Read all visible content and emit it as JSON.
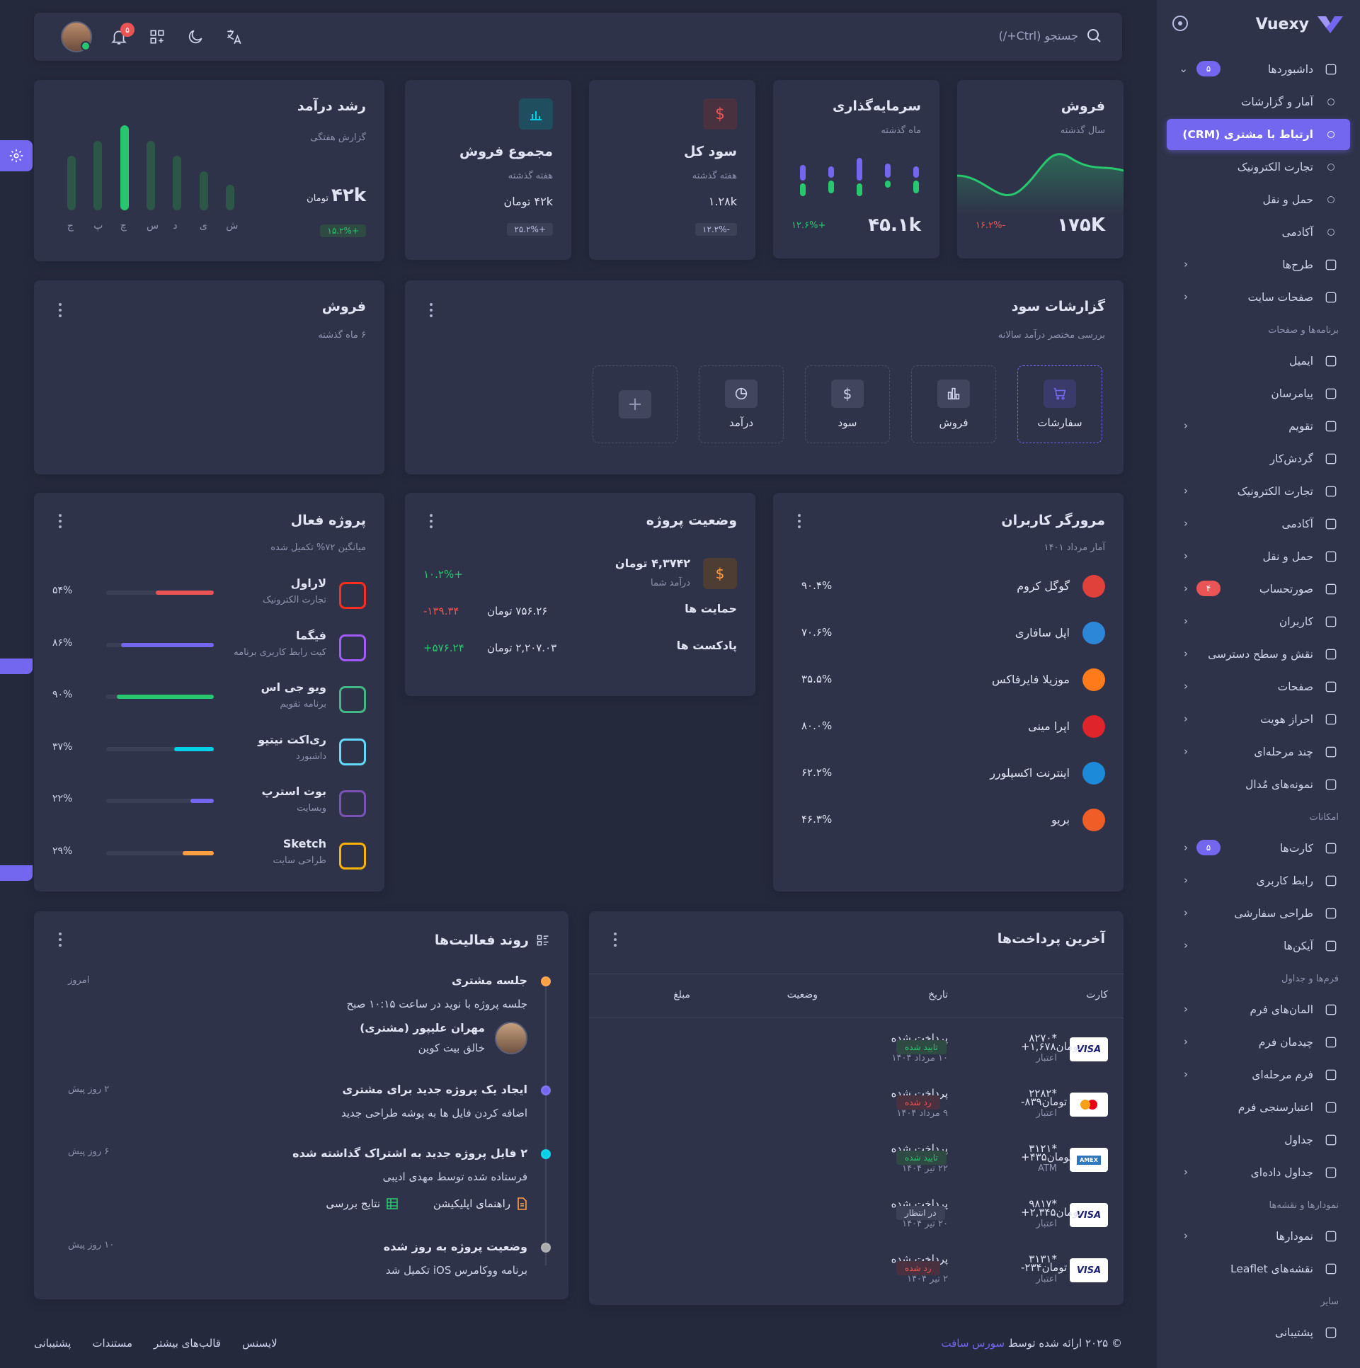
{
  "brand": {
    "name": "Vuexy",
    "accent": "#7367f0"
  },
  "navbar": {
    "search_placeholder": "جستجو (Ctrl+/)",
    "notifications_count": "۵"
  },
  "sidebar": {
    "items": [
      {
        "label": "داشبوردها",
        "icon": "home-icon",
        "badge": "۵",
        "chevron": "⌄"
      },
      {
        "label": "آمار و گزارشات",
        "sub": true
      },
      {
        "label": "ارتباط با مشتری (CRM)",
        "sub": true,
        "active": true
      },
      {
        "label": "تجارت الکترونیک",
        "sub": true
      },
      {
        "label": "حمل و نقل",
        "sub": true
      },
      {
        "label": "آکادمی",
        "sub": true
      },
      {
        "label": "طرح‌ها",
        "icon": "layout-icon",
        "chevron": "‹"
      },
      {
        "label": "صفحات سایت",
        "icon": "files-icon",
        "chevron": "‹"
      },
      {
        "section": "برنامه‌ها و صفحات"
      },
      {
        "label": "ایمیل",
        "icon": "mail-icon"
      },
      {
        "label": "پیامرسان",
        "icon": "chat-icon"
      },
      {
        "label": "تقویم",
        "icon": "calendar-icon",
        "chevron": "‹"
      },
      {
        "label": "گردش‌کار",
        "icon": "kanban-icon"
      },
      {
        "label": "تجارت الکترونیک",
        "icon": "cart-icon",
        "chevron": "‹"
      },
      {
        "label": "آکادمی",
        "icon": "book-icon",
        "chevron": "‹"
      },
      {
        "label": "حمل و نقل",
        "icon": "truck-icon",
        "chevron": "‹"
      },
      {
        "label": "صورتحساب",
        "icon": "invoice-icon",
        "badge": "۴",
        "badge_red": true,
        "chevron": "‹"
      },
      {
        "label": "کاربران",
        "icon": "users-icon",
        "chevron": "‹"
      },
      {
        "label": "نقش و سطح دسترسی",
        "icon": "settings-icon",
        "chevron": "‹"
      },
      {
        "label": "صفحات",
        "icon": "file-icon",
        "chevron": "‹"
      },
      {
        "label": "احراز هویت",
        "icon": "lock-icon",
        "chevron": "‹"
      },
      {
        "label": "چند مرحله‌ای",
        "icon": "steps-icon",
        "chevron": "‹"
      },
      {
        "label": "نمونه‌های مُدال",
        "icon": "square-icon"
      },
      {
        "section": "امکانات"
      },
      {
        "label": "کارت‌ها",
        "icon": "id-card-icon",
        "badge": "۵",
        "chevron": "‹"
      },
      {
        "label": "رابط کاربری",
        "icon": "ui-icon",
        "chevron": "‹"
      },
      {
        "label": "طراحی سفارشی",
        "icon": "components-icon",
        "chevron": "‹"
      },
      {
        "label": "آیکن‌ها",
        "icon": "icons-icon",
        "chevron": "‹"
      },
      {
        "section": "فرم‌ها و جداول"
      },
      {
        "label": "المان‌های فرم",
        "icon": "toggle-icon",
        "chevron": "‹"
      },
      {
        "label": "چیدمان فرم",
        "icon": "form-layout-icon",
        "chevron": "‹"
      },
      {
        "label": "فرم مرحله‌ای",
        "icon": "wizard-icon",
        "chevron": "‹"
      },
      {
        "label": "اعتبارسنجی فرم",
        "icon": "checkbox-icon"
      },
      {
        "label": "جداول",
        "icon": "table-icon"
      },
      {
        "label": "جداول داده‌ای",
        "icon": "grid-icon",
        "chevron": "‹"
      },
      {
        "section": "نمودارها و نقشه‌ها"
      },
      {
        "label": "نمودارها",
        "icon": "chart-icon",
        "chevron": "‹"
      },
      {
        "label": "نقشه‌های Leaflet",
        "icon": "map-icon"
      },
      {
        "section": "سایر"
      },
      {
        "label": "پشتیبانی",
        "icon": "support-icon"
      }
    ]
  },
  "sales_card": {
    "title": "فروش",
    "sub": "سال گذشته",
    "value": "۱۷۵K",
    "change": "-۱۶.۲%"
  },
  "investment_card": {
    "title": "سرمایه‌گذاری",
    "sub": "ماه گذشته",
    "value": "۴۵.۱k",
    "change": "+۱۲.۶%"
  },
  "profit_card": {
    "title": "سود کل",
    "sub": "هفته گذشته",
    "value": "۱.۲۸k",
    "change": "-۱۲.۲%"
  },
  "total_sales_card": {
    "title": "مجموع فروش",
    "sub": "هفته گذشته",
    "value": "۴۲k تومان",
    "change": "+۲۵.۲%"
  },
  "revenue_card": {
    "title": "رشد درآمد",
    "sub": "گزارش هفتگی",
    "value": "۴۲k",
    "unit": "تومان",
    "change": "+۱۵.۲%",
    "days": [
      "ش",
      "ی",
      "د",
      "س",
      "چ",
      "پ",
      "ج"
    ],
    "bar_levels": [
      0.3,
      0.46,
      0.64,
      0.82,
      1.0,
      0.82,
      0.64
    ],
    "highlight_index": 4
  },
  "profit_reports": {
    "title": "گزارشات سود",
    "sub": "بررسی مختصر درآمد سالانه",
    "options": [
      "سفارشات",
      "فروش",
      "سود",
      "درآمد"
    ]
  },
  "sales_empty": {
    "title": "فروش",
    "sub": "۶ ماه گذشته"
  },
  "browsers": {
    "title": "مرورگر کاربران",
    "sub": "آمار مرداد ۱۴۰۱",
    "rows": [
      {
        "name": "گوگل کروم",
        "value": "۹۰.۴%",
        "logo": "chrome-icon"
      },
      {
        "name": "اپل سافاری",
        "value": "۷۰.۶%",
        "logo": "safari-icon"
      },
      {
        "name": "موزیلا فایرفاکس",
        "value": "۳۵.۵%",
        "logo": "firefox-icon"
      },
      {
        "name": "اپرا مینی",
        "value": "۸۰.۰%",
        "logo": "opera-icon"
      },
      {
        "name": "اینترنت اکسپلورر",
        "value": "۶۲.۲%",
        "logo": "ie-icon"
      },
      {
        "name": "بریو",
        "value": "۴۶.۳%",
        "logo": "brave-icon"
      }
    ]
  },
  "project_status": {
    "title": "وضعیت پروژه",
    "amount": "۴,۳۷۴۲ تومان",
    "amount_sub": "درآمد شما",
    "amount_change": "+۱۰.۲%",
    "rows": [
      {
        "label": "حمایت ها",
        "value": "۷۵۶.۲۶ تومان",
        "change": "-۱۳۹.۳۴"
      },
      {
        "label": "پادکست ها",
        "value": "۲,۲۰۷.۰۳ تومان",
        "change": "+۵۷۶.۲۴"
      }
    ]
  },
  "active_projects": {
    "title": "پروژه فعال",
    "sub": "میانگین ۷۲% تکمیل شده",
    "rows": [
      {
        "name": "لاراول",
        "desc": "تجارت الکترونیک",
        "pct": "۵۴%",
        "level": 0.54,
        "color": "#ea5455",
        "logo": "laravel-icon"
      },
      {
        "name": "فیگما",
        "desc": "کیت رابط کاربری برنامه",
        "pct": "۸۶%",
        "level": 0.86,
        "color": "#7367f0",
        "logo": "figma-icon"
      },
      {
        "name": "ویو جی اس",
        "desc": "برنامه تقویم",
        "pct": "۹۰%",
        "level": 0.9,
        "color": "#28c76f",
        "logo": "vue-icon"
      },
      {
        "name": "ری‌اکت نیتیو",
        "desc": "داشبورد",
        "pct": "۳۷%",
        "level": 0.37,
        "color": "#00cfe8",
        "logo": "react-icon"
      },
      {
        "name": "بوت استرپ",
        "desc": "وبسایت",
        "pct": "۲۲%",
        "level": 0.22,
        "color": "#7367f0",
        "logo": "bootstrap-icon"
      },
      {
        "name": "Sketch",
        "desc": "طراحی سایت",
        "pct": "۲۹%",
        "level": 0.29,
        "color": "#ff9f43",
        "logo": "sketch-icon"
      }
    ]
  },
  "activity": {
    "title": "روند فعالیت‌ها",
    "items": [
      {
        "title": "جلسه مشتری",
        "text": "جلسه پروژه با نوید در ساعت ۱۰:۱۵ صبح",
        "time": "امروز",
        "color": "#ff9f43",
        "person": "مهران علیپور (مشتری)",
        "role": "خالق بیت کوین"
      },
      {
        "title": "ایجاد یک پروژه جدید برای مشتری",
        "text": "اضافه کردن فایل ها به پوشه طراحی جدید",
        "time": "۲ روز پیش",
        "color": "#7367f0"
      },
      {
        "title": "۲ فایل پروژه جدید به اشتراک گذاشته شده",
        "text": "فرستاده شده توسط مهدی ادیبی",
        "time": "۶ روز پیش",
        "color": "#00cfe8",
        "files": [
          "راهنمای اپلیکیشن",
          "نتایج بررسی"
        ]
      },
      {
        "title": "وضعیت پروژه به روز شده",
        "text": "برنامه ووکامرس iOS تکمیل شد",
        "time": "۱۰ روز پیش",
        "color": "#a8aaae"
      }
    ]
  },
  "payments": {
    "title": "آخرین پرداخت‌ها",
    "headers": [
      "کارت",
      "تاریخ",
      "وضعیت",
      "مبلغ"
    ],
    "rows": [
      {
        "brand": "VISA",
        "num": "*۸۲۷۰",
        "type": "اعتبار",
        "status": "پرداخت شده",
        "date": "۱۰ مرداد ۱۴۰۴",
        "badge": "تایید شده",
        "kind": "ok",
        "amount": "+۱,۶۷۸تومان"
      },
      {
        "brand": "mastercard",
        "num": "*۲۲۸۲",
        "type": "اعتبار",
        "status": "پرداخت شده",
        "date": "۹ مرداد ۱۴۰۴",
        "badge": "رد شده",
        "kind": "no",
        "amount": "-۸۳۹تومان"
      },
      {
        "brand": "AMEX",
        "num": "*۳۱۲۱",
        "type": "ATM",
        "status": "پرداخت شده",
        "date": "۲۲ تیر ۱۴۰۴",
        "badge": "تایید شده",
        "kind": "ok",
        "amount": "+۴۳۵تومان"
      },
      {
        "brand": "VISA",
        "num": "*۹۸۱۷",
        "type": "اعتبار",
        "status": "پرداخت شده",
        "date": "۲۰ تیر ۱۴۰۴",
        "badge": "در انتظار",
        "kind": "wait",
        "amount": "+۲,۳۴۵تومان"
      },
      {
        "brand": "VISA",
        "num": "*۳۱۳۱",
        "type": "اعتبار",
        "status": "پرداخت شده",
        "date": "۲ تیر ۱۴۰۴",
        "badge": "رد شده",
        "kind": "no",
        "amount": "-۲۳۴تومان"
      }
    ]
  },
  "footer": {
    "copyright": "© ۲۰۲۵ ارائه شده توسط",
    "company": "سورس سافت",
    "links": [
      "لایسنس",
      "قالب‌های بیشتر",
      "مستندات",
      "پشتیبانی"
    ]
  }
}
